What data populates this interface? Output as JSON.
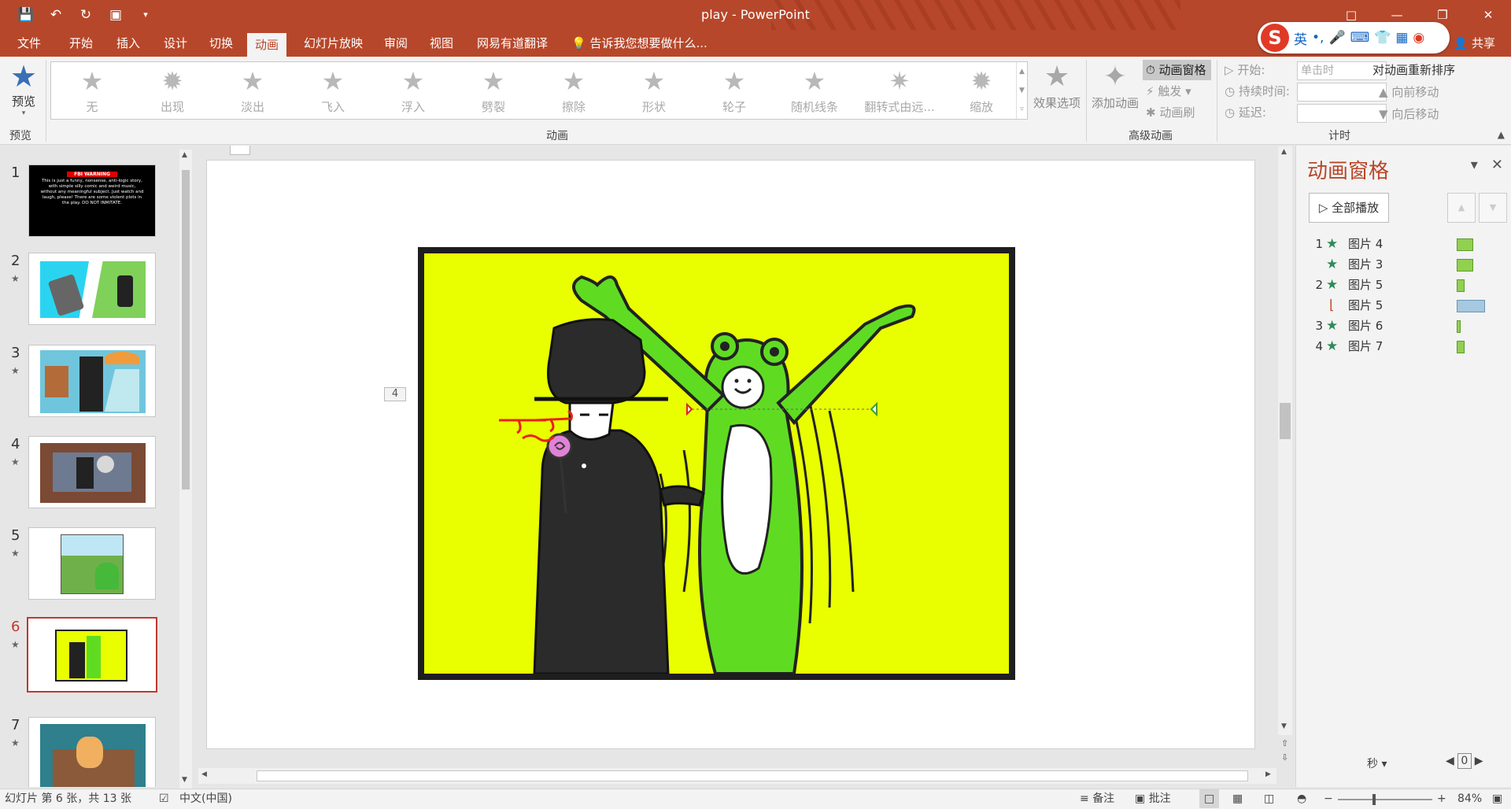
{
  "window": {
    "title": "play - PowerPoint",
    "share_label": "共享",
    "controls": [
      "restore-ribbon-icon",
      "minimize-icon",
      "maximize-icon",
      "close-icon"
    ]
  },
  "quick_access": {
    "icons": [
      "save-icon",
      "undo-icon",
      "redo-icon",
      "start-slideshow-icon",
      "customize-icon"
    ]
  },
  "tabs": [
    {
      "label": "文件"
    },
    {
      "label": "开始"
    },
    {
      "label": "插入"
    },
    {
      "label": "设计"
    },
    {
      "label": "切换"
    },
    {
      "label": "动画",
      "active": true
    },
    {
      "label": "幻灯片放映"
    },
    {
      "label": "审阅"
    },
    {
      "label": "视图"
    },
    {
      "label": "网易有道翻译"
    }
  ],
  "tell_me": "告诉我您想要做什么...",
  "ime_bar": {
    "logo": "S",
    "mode": "英",
    "punct": "•,",
    "icons": [
      "mic-icon",
      "keyboard-icon",
      "skin-icon",
      "toolbox-icon",
      "avatar-icon"
    ]
  },
  "ribbon": {
    "preview": {
      "label": "预览",
      "group": "预览"
    },
    "animations": [
      {
        "label": "无"
      },
      {
        "label": "出现"
      },
      {
        "label": "淡出"
      },
      {
        "label": "飞入"
      },
      {
        "label": "浮入"
      },
      {
        "label": "劈裂"
      },
      {
        "label": "擦除"
      },
      {
        "label": "形状"
      },
      {
        "label": "轮子"
      },
      {
        "label": "随机线条"
      },
      {
        "label": "翻转式由远..."
      },
      {
        "label": "缩放"
      }
    ],
    "animation_group": "动画",
    "effect_options": "效果选项",
    "add_animation": "添加动画",
    "advanced": {
      "pane": "动画窗格",
      "trigger": "触发",
      "painter": "动画刷",
      "group": "高级动画"
    },
    "timing": {
      "start_label": "开始:",
      "start_value": "单击时",
      "duration_label": "持续时间:",
      "delay_label": "延迟:",
      "group": "计时"
    },
    "reorder": {
      "title": "对动画重新排序",
      "earlier": "向前移动",
      "later": "向后移动"
    }
  },
  "thumbnails": [
    {
      "num": "1",
      "has_anim": false,
      "warning_title": "FBI WARNING",
      "warning_text": "This is just a funny, nonsense, anti-logic story, with simple silly comic and weird music, without any meaningful subject. Just watch and laugh, please! There are some violent plots in the play. DO NOT INMITATE."
    },
    {
      "num": "2",
      "has_anim": true
    },
    {
      "num": "3",
      "has_anim": true
    },
    {
      "num": "4",
      "has_anim": true
    },
    {
      "num": "5",
      "has_anim": true
    },
    {
      "num": "6",
      "has_anim": true,
      "active": true
    },
    {
      "num": "7",
      "has_anim": true
    }
  ],
  "slide": {
    "anim_tag": "4",
    "art_colors": {
      "background": "#e9ff00",
      "frame": "#1e1e1e",
      "frog": "#5fdc22"
    }
  },
  "animation_pane": {
    "title": "动画窗格",
    "play_all": "全部播放",
    "items": [
      {
        "num": "1",
        "name": "图片 4",
        "bar": "green",
        "bar_level": 0.8
      },
      {
        "num": "",
        "name": "图片 3",
        "bar": "green",
        "bar_level": 0.8
      },
      {
        "num": "2",
        "name": "图片 5",
        "bar": "green",
        "bar_level": 0.4
      },
      {
        "num": "",
        "name": "图片 5",
        "bar": "blue",
        "bar_level": 1.4,
        "motion": true
      },
      {
        "num": "3",
        "name": "图片 6",
        "bar": "green",
        "bar_level": 0.2
      },
      {
        "num": "4",
        "name": "图片 7",
        "bar": "green",
        "bar_level": 0.4
      }
    ],
    "seconds_label": "秒",
    "zoom_value": "0"
  },
  "status": {
    "slide_info": "幻灯片 第 6 张，共 13 张",
    "language": "中文(中国)",
    "notes": "备注",
    "comments": "批注",
    "zoom": "84%"
  }
}
